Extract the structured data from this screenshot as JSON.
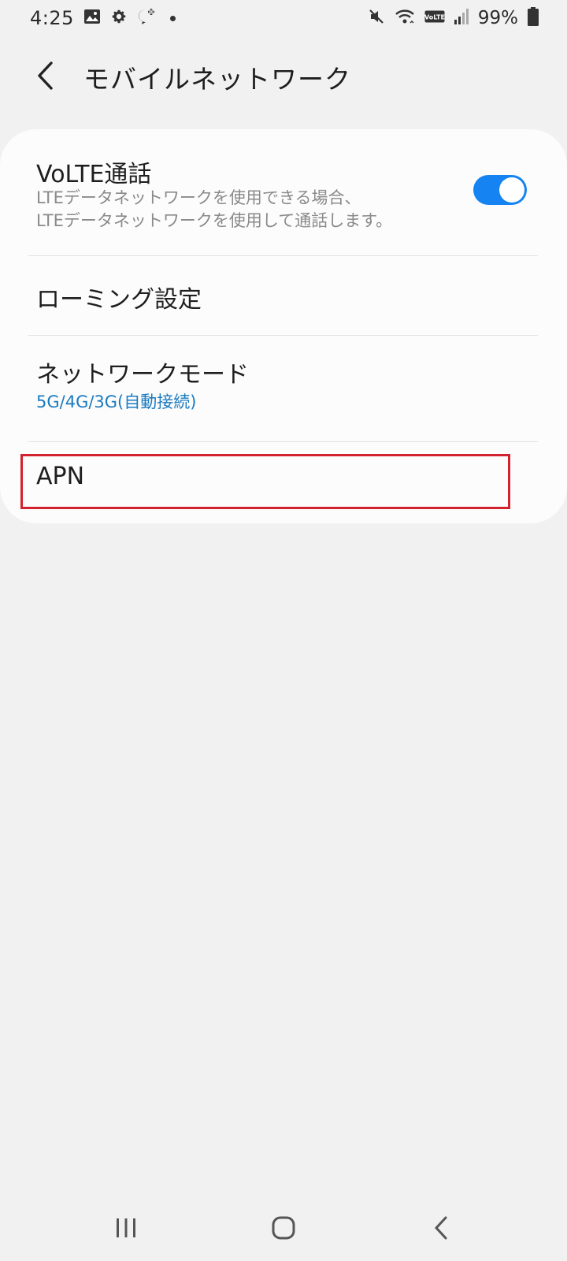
{
  "status_bar": {
    "time": "4:25",
    "battery_text": "99%",
    "icons": [
      "image-icon",
      "gear-icon",
      "chat-plus-icon",
      "mute-icon",
      "wifi-icon",
      "volte-icon",
      "signal-icon",
      "battery-icon"
    ]
  },
  "header": {
    "title": "モバイルネットワーク",
    "back_icon": "chevron-left-icon"
  },
  "settings": {
    "volte": {
      "title": "VoLTE通話",
      "subtitle_line1": "LTEデータネットワークを使用できる場合、",
      "subtitle_line2": "LTEデータネットワークを使用して通話します。",
      "enabled": true
    },
    "roaming": {
      "title": "ローミング設定"
    },
    "network_mode": {
      "title": "ネットワークモード",
      "value": "5G/4G/3G(自動接続)"
    },
    "apn": {
      "title": "APN"
    }
  },
  "colors": {
    "accent": "#1683f2",
    "value_text": "#1a7abf",
    "highlight_border": "#d2222d",
    "background": "#f1f1f1",
    "card": "#fcfcfc"
  },
  "nav_bar": {
    "icons": [
      "recent-apps-icon",
      "home-icon",
      "back-icon"
    ]
  }
}
